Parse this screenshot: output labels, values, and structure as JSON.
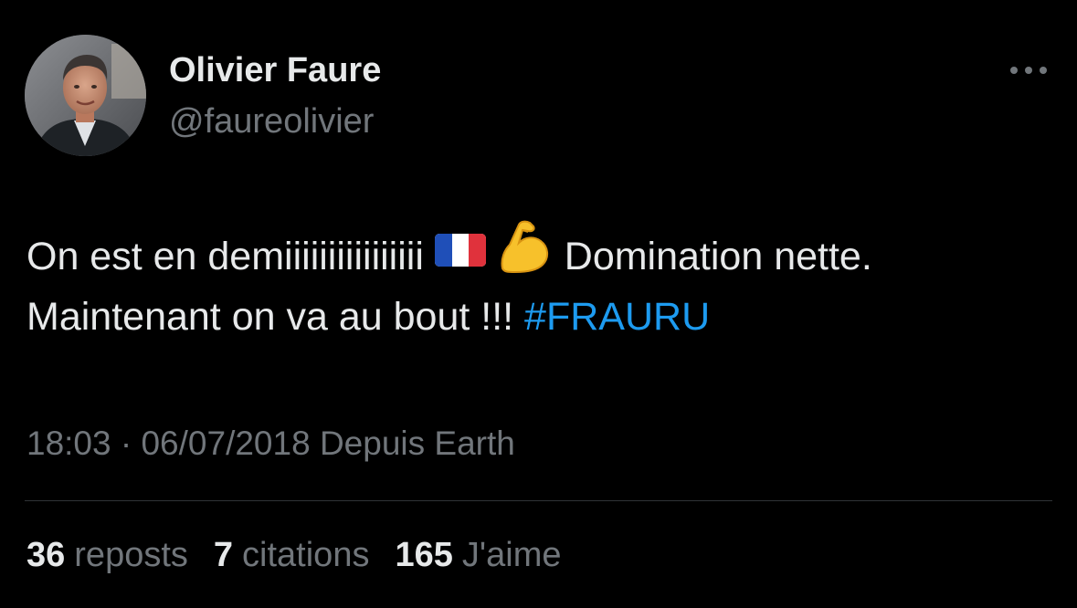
{
  "author": {
    "name": "Olivier Faure",
    "handle": "@faureolivier"
  },
  "tweet": {
    "line1_before": "On est en demiiiiiiiiiiiiiiii",
    "line1_after": "Domination nette.",
    "line2_before": "Maintenant on va au bout !!!",
    "hashtag": "#FRAURU",
    "emojis": [
      "flag-france-icon",
      "flexed-biceps-icon"
    ]
  },
  "meta": {
    "time": "18:03",
    "separator": "·",
    "date": "06/07/2018",
    "source": "Depuis Earth"
  },
  "stats": {
    "reposts_count": "36",
    "reposts_label": "reposts",
    "quotes_count": "7",
    "quotes_label": "citations",
    "likes_count": "165",
    "likes_label": "J'aime"
  },
  "colors": {
    "background": "#000000",
    "text_primary": "#e7e9ea",
    "text_secondary": "#71767b",
    "link": "#1d9bf0",
    "divider": "#2f3336"
  }
}
